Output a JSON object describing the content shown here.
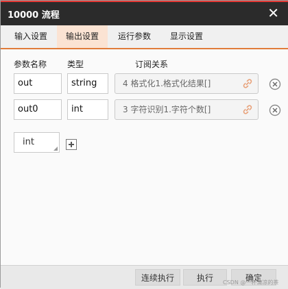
{
  "window": {
    "title": "10000 流程"
  },
  "tabs": [
    {
      "label": "输入设置"
    },
    {
      "label": "输出设置"
    },
    {
      "label": "运行参数"
    },
    {
      "label": "显示设置"
    }
  ],
  "headers": {
    "name": "参数名称",
    "type": "类型",
    "subscription": "订阅关系"
  },
  "rows": [
    {
      "name": "out",
      "type": "string",
      "subscription": "4 格式化1.格式化结果[]"
    },
    {
      "name": "out0",
      "type": "int",
      "subscription": "3 字符识别1.字符个数[]"
    }
  ],
  "new_param": {
    "type_value": "int"
  },
  "footer": {
    "continuous": "连续执行",
    "execute": "执行",
    "confirm": "确定"
  },
  "watermark": "CSDN @一杯清凉的茶"
}
